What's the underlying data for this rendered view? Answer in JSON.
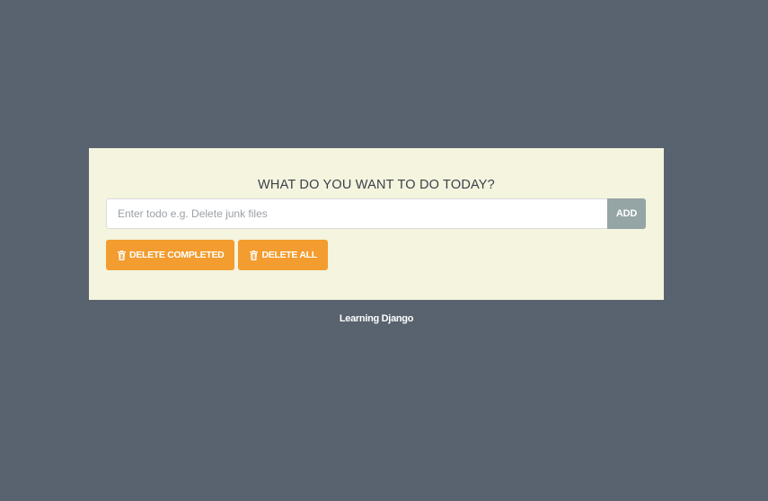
{
  "app": {
    "heading": "WHAT DO YOU WANT TO DO TODAY?",
    "footer": "Learning Django"
  },
  "todo_form": {
    "input_value": "",
    "input_placeholder": "Enter todo e.g. Delete junk files",
    "add_label": "ADD"
  },
  "actions": {
    "delete_completed_label": "DELETE COMPLETED",
    "delete_all_label": "DELETE ALL",
    "icon": "trash-icon"
  },
  "colors": {
    "background": "#59636f",
    "panel": "#f4f4df",
    "accent": "#f39c2f",
    "add_button": "#95a5a6"
  }
}
